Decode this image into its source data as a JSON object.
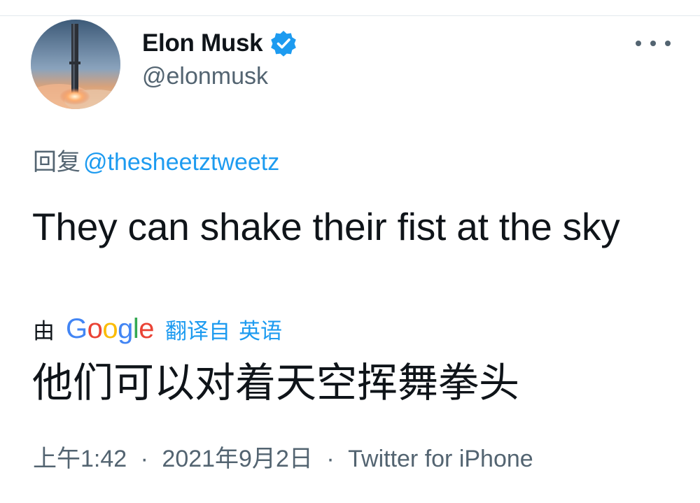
{
  "author": {
    "name": "Elon Musk",
    "handle": "@elonmusk",
    "verified": true
  },
  "reply": {
    "prefix": "回复",
    "mention": "@thesheetztweetz"
  },
  "tweet": {
    "text": "They can shake their fist at the sky"
  },
  "translation": {
    "by": "由",
    "provider_letters": [
      "G",
      "o",
      "o",
      "g",
      "l",
      "e"
    ],
    "from": "翻译自",
    "language": "英语",
    "text": "他们可以对着天空挥舞拳头"
  },
  "meta": {
    "time": "上午1:42",
    "separator": "·",
    "date": "2021年9月2日",
    "source": "Twitter for iPhone"
  },
  "icons": {
    "verified": "verified-badge-icon",
    "more": "more-options-icon"
  },
  "colors": {
    "accent": "#1d9bf0",
    "text_primary": "#0f1419",
    "text_secondary": "#536471",
    "google_blue": "#4285f4",
    "google_red": "#ea4335",
    "google_yellow": "#fbbc05",
    "google_green": "#34a853"
  }
}
